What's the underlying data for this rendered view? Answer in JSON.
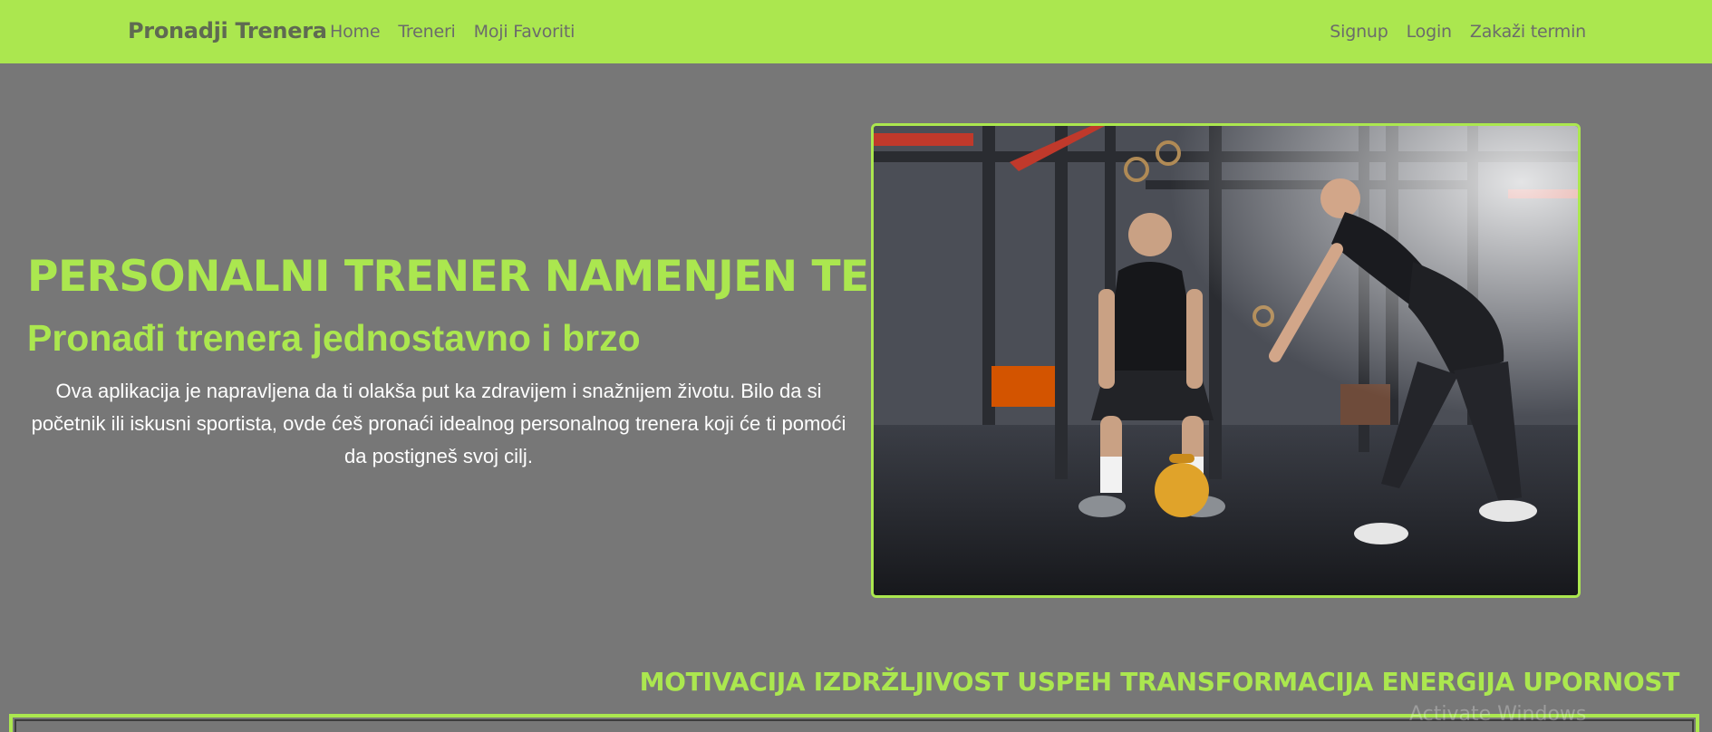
{
  "navbar": {
    "brand": "Pronadji Trenera",
    "left_links": [
      "Home",
      "Treneri",
      "Moji Favoriti"
    ],
    "right_links": [
      "Signup",
      "Login",
      "Zakaži termin"
    ]
  },
  "hero": {
    "title": "PERSONALNI TRENER NAMENJEN TEBI",
    "subtitle": "Pronađi trenera jednostavno i brzo",
    "description": "Ova aplikacija je napravljena da ti olakša put ka zdravijem i snažnijem životu. Bilo da si početnik ili iskusni sportista, ovde ćeš pronaći idealnog personalnog trenera koji će ti pomoći da postigneš svoj cilj."
  },
  "motto": "MOTIVACIJA IZDRŽLJIVOST USPEH TRANSFORMACIJA ENERGIJA UPORNOST",
  "watermark": "Activate Windows",
  "colors": {
    "accent": "#abe74f",
    "background": "#777777",
    "nav_text": "#6b6b6b",
    "brand_text": "#5f6a52"
  }
}
